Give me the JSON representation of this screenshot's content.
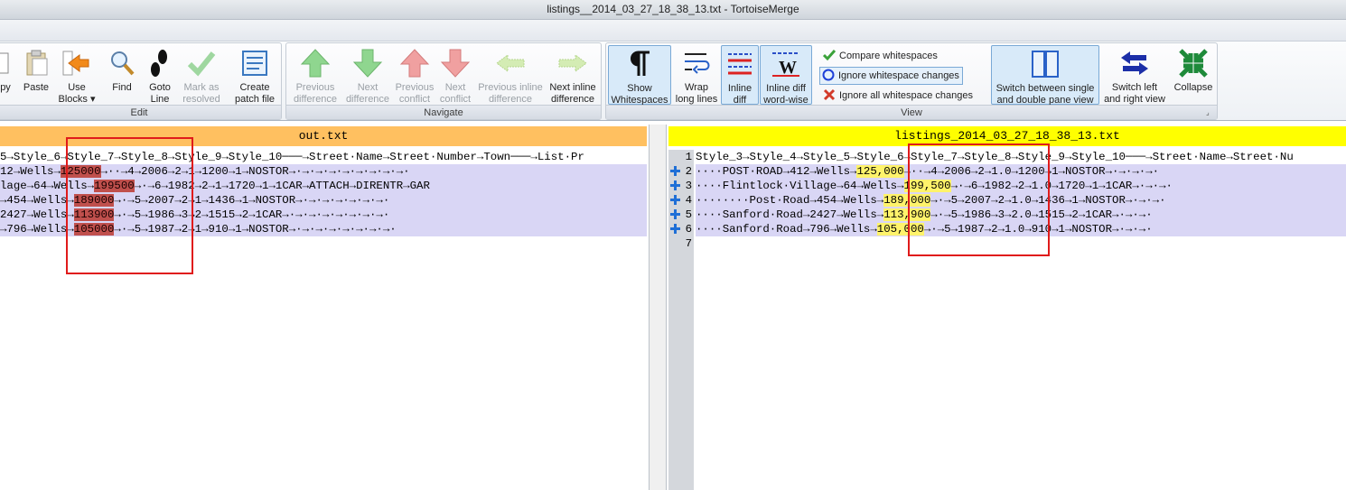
{
  "window": {
    "title": "listings__2014_03_27_18_38_13.txt - TortoiseMerge"
  },
  "ribbon": {
    "groups": {
      "edit": "Edit",
      "navigate": "Navigate",
      "view": "View"
    },
    "buttons": {
      "copy": "py",
      "paste": "Paste",
      "use_blocks": "Use\nBlocks ▾",
      "find": "Find",
      "goto_line": "Goto\nLine",
      "mark_resolved": "Mark as\nresolved",
      "create_patch": "Create\npatch file",
      "prev_diff": "Previous\ndifference",
      "next_diff": "Next\ndifference",
      "prev_conflict": "Previous\nconflict",
      "next_conflict": "Next\nconflict",
      "prev_inline": "Previous inline\ndifference",
      "next_inline": "Next inline\ndifference",
      "show_ws": "Show\nWhitespaces",
      "wrap": "Wrap\nlong lines",
      "inline_diff": "Inline\ndiff",
      "inline_word": "Inline diff\nword-wise",
      "compare_ws": "Compare whitespaces",
      "ignore_ws_changes": "Ignore whitespace changes",
      "ignore_all_ws": "Ignore all whitespace changes",
      "switch_single_double": "Switch between single\nand double pane view",
      "switch_lr": "Switch left\nand right view",
      "collapse": "Collapse"
    }
  },
  "left_pane": {
    "title": "out.txt",
    "lines": [
      [
        "5→Style_6→Style_7→Style_8→Style_9→Style_10───→Street·Name→Street·Number→Town───→List·Pr",
        "",
        ""
      ],
      [
        "12→Wells→",
        "125000",
        "→··→4→2006→2→1→1200→1→NOSTOR→·→·→·→·→·→·→·→·→·"
      ],
      [
        "lage→64→Wells→",
        "199500",
        "→·→6→1982→2→1→1720→1→1CAR→ATTACH→DIRENTR→GAR"
      ],
      [
        "→454→Wells→",
        "189000",
        "→·→5→2007→2→1→1436→1→NOSTOR→·→·→·→·→·→·→·"
      ],
      [
        "2427→Wells→",
        "113900",
        "→·→5→1986→3→2→1515→2→1CAR→·→·→·→·→·→·→·→·"
      ],
      [
        "→796→Wells→",
        "105000",
        "→·→5→1987→2→1→910→1→NOSTOR→·→·→·→·→·→·→·→·"
      ]
    ]
  },
  "right_pane": {
    "title": "listings_2014_03_27_18_38_13.txt",
    "line_numbers": [
      "1",
      "2",
      "3",
      "4",
      "5",
      "6",
      "7"
    ],
    "lines": [
      [
        "Style_3→Style_4→Style_5→Style_6→Style_7→Style_8→Style_9→Style_10───→Street·Name→Street·Nu",
        "",
        ""
      ],
      [
        "····POST·ROAD→412→Wells→",
        "125,000",
        "→··→4→2006→2→1.0→1200→1→NOSTOR→·→·→·→·"
      ],
      [
        "····Flintlock·Village→64→Wells→",
        "199,500",
        "→·→6→1982→2→1.0→1720→1→1CAR→·→·→·"
      ],
      [
        "········Post·Road→454→Wells→",
        "189,000",
        "→·→5→2007→2→1.0→1436→1→NOSTOR→·→·→·"
      ],
      [
        "····Sanford·Road→2427→Wells→",
        "113,900",
        "→·→5→1986→3→2.0→1515→2→1CAR→·→·→·"
      ],
      [
        "····Sanford·Road→796→Wells→",
        "105,000",
        "→·→5→1987→2→1.0→910→1→NOSTOR→·→·→·"
      ],
      [
        "",
        "",
        ""
      ]
    ]
  },
  "colors": {
    "left_header": "#ffc060",
    "right_header": "#ffff00",
    "changed_line": "#d9d6f5",
    "removed_value": "#c0504d",
    "added_value": "#fff36b",
    "annotation_box": "#e01b1b"
  }
}
